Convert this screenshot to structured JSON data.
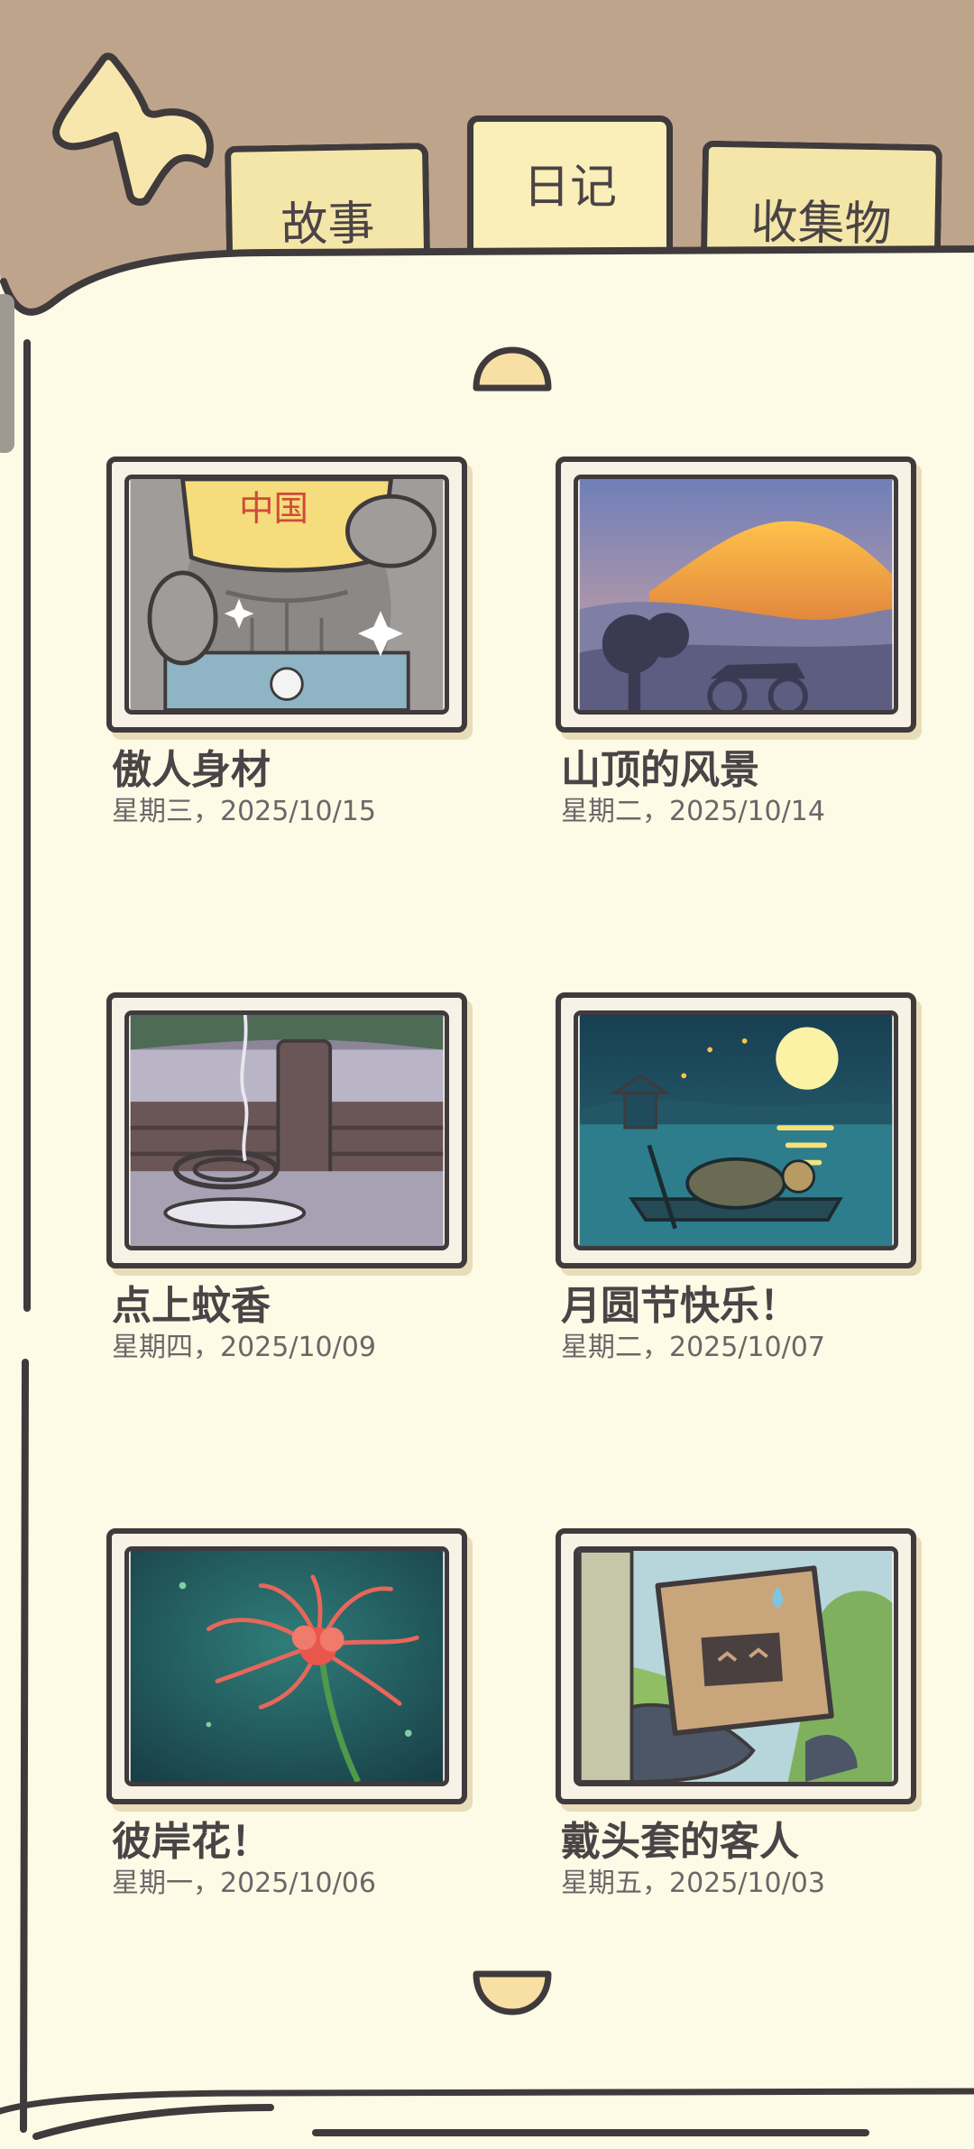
{
  "tabs": [
    {
      "label": "故事",
      "active": false
    },
    {
      "label": "日记",
      "active": true
    },
    {
      "label": "收集物",
      "active": false
    }
  ],
  "entries": [
    {
      "title": "傲人身材",
      "date": "星期三，2025/10/15",
      "picture": "cat-showing-abs-image"
    },
    {
      "title": "山顶的风景",
      "date": "星期二，2025/10/14",
      "picture": "mountain-sunset-image"
    },
    {
      "title": "点上蚊香",
      "date": "星期四，2025/10/09",
      "picture": "mosquito-coil-image"
    },
    {
      "title": "月圆节快乐！",
      "date": "星期二，2025/10/07",
      "picture": "full-moon-lake-image"
    },
    {
      "title": "彼岸花！",
      "date": "星期一，2025/10/06",
      "picture": "red-spider-lily-image"
    },
    {
      "title": "戴头套的客人",
      "date": "星期五，2025/10/03",
      "picture": "box-head-guest-image"
    }
  ],
  "colors": {
    "background": "#bfa48c",
    "paper": "#fdfbe6",
    "tab": "#f4e6a8",
    "outline": "#3f3a3c",
    "text": "#4a4446"
  },
  "icons": {
    "back": "back-arrow-icon",
    "scroll_up": "scroll-up-knob-icon",
    "scroll_down": "scroll-down-knob-icon"
  }
}
